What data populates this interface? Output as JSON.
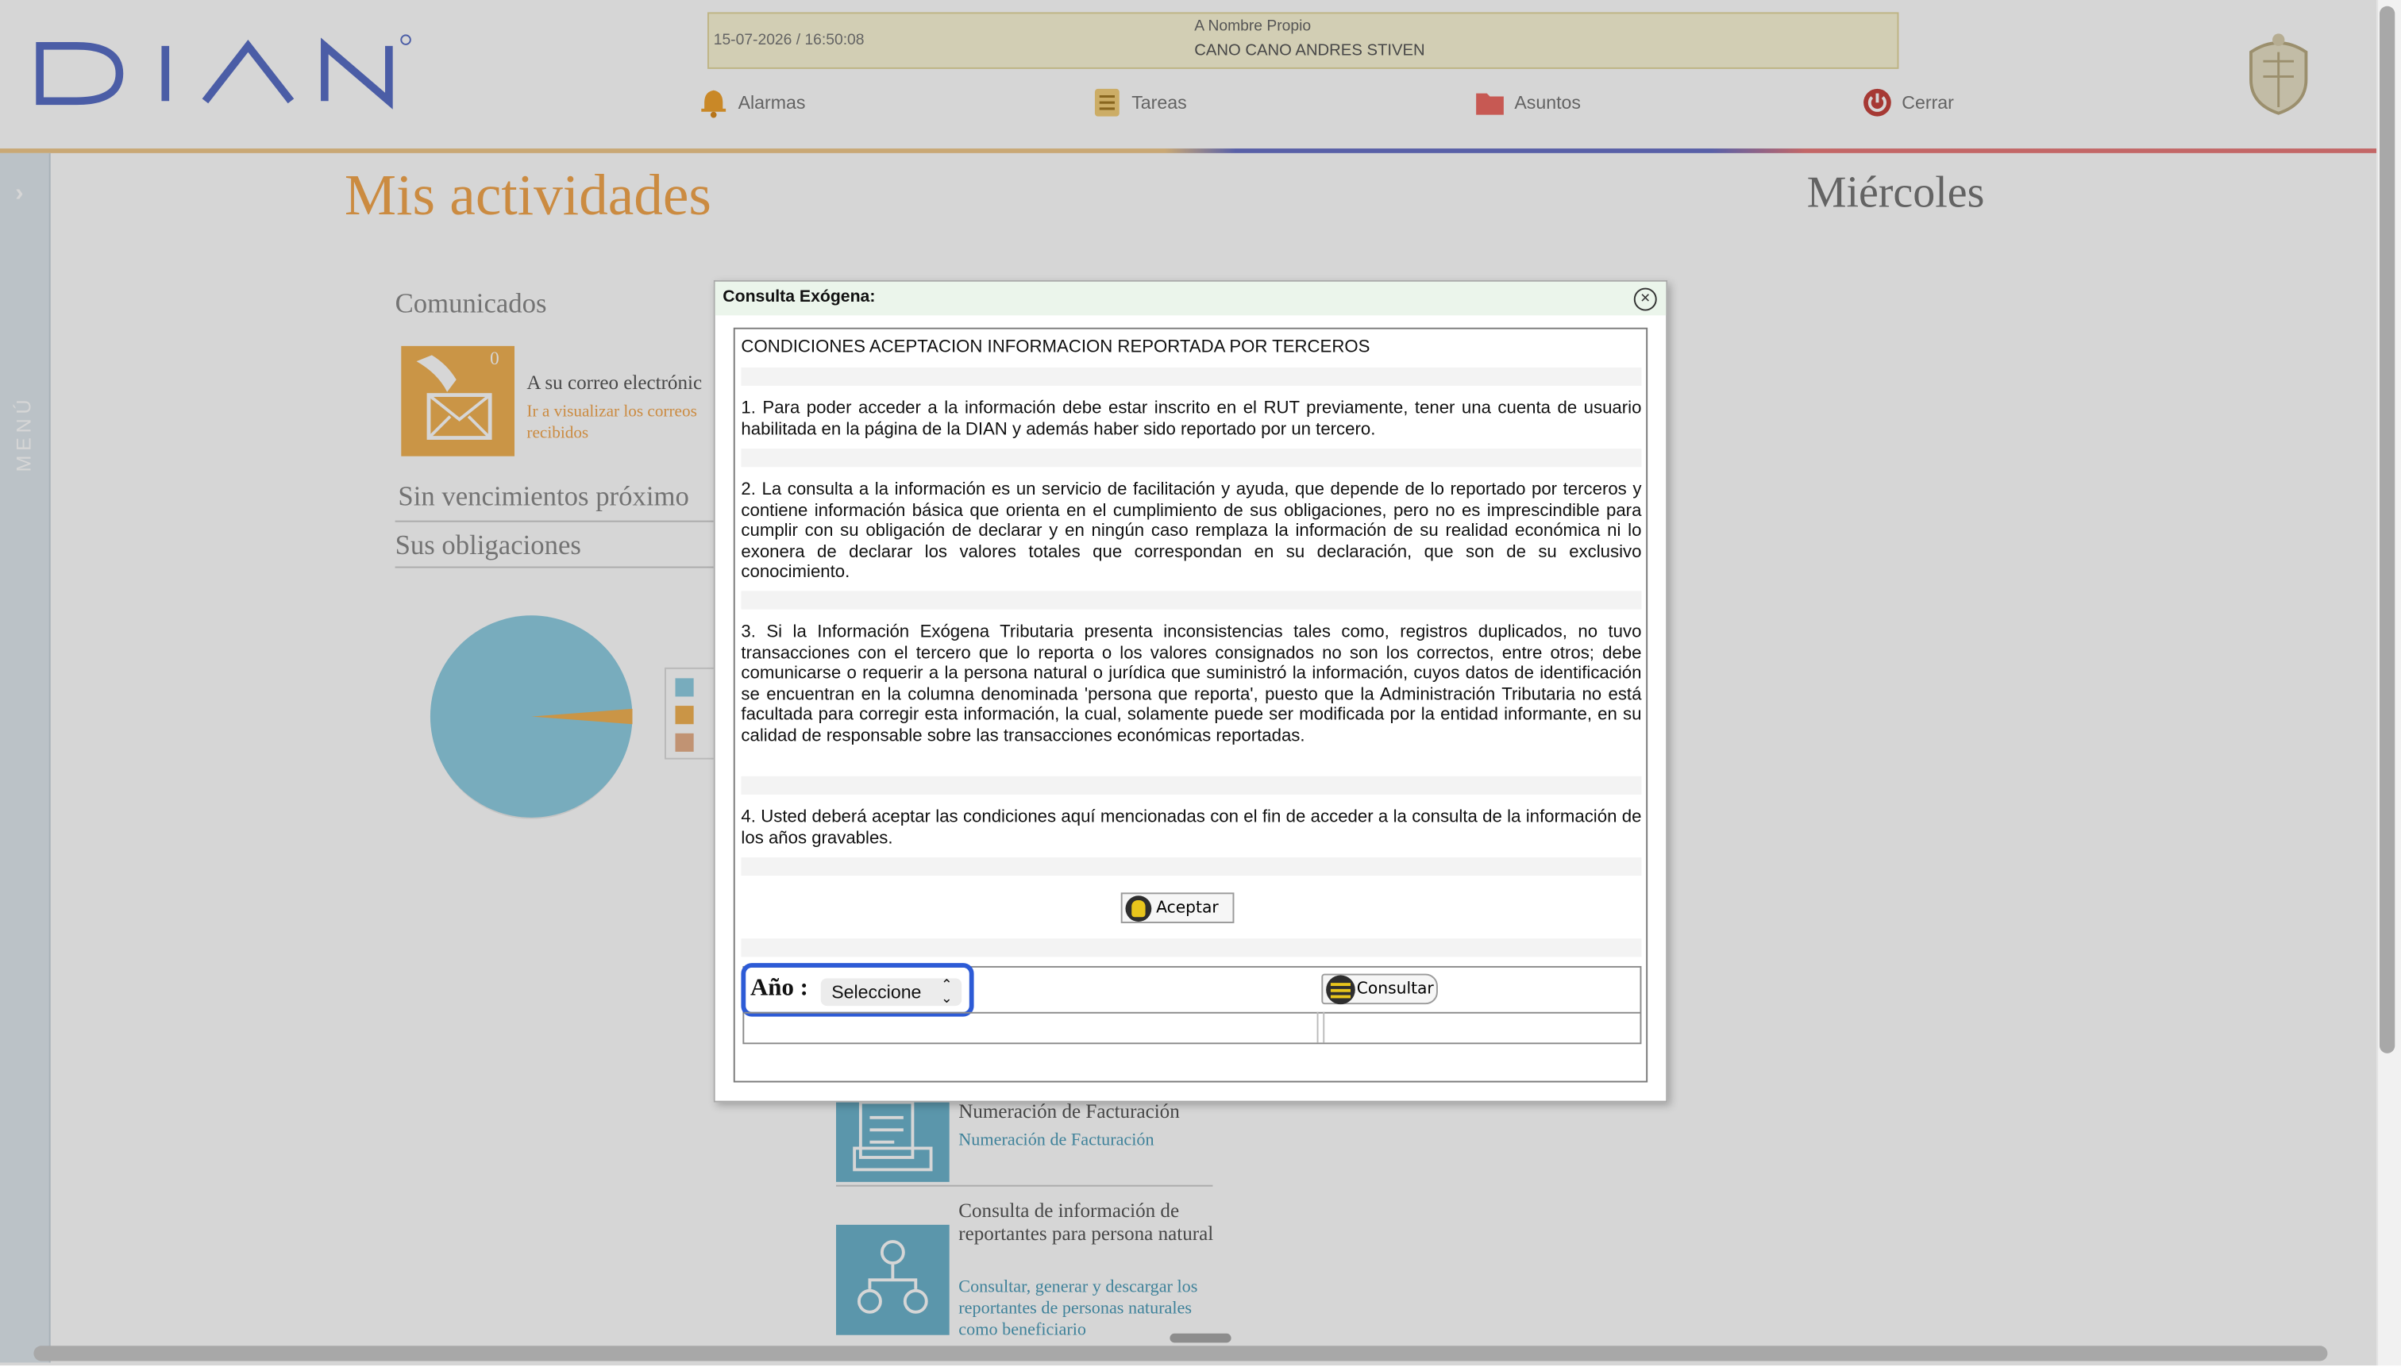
{
  "header": {
    "datetime": "15-07-2026 / 16:50:08",
    "user_type": "A Nombre Propio",
    "user_name": "CANO CANO ANDRES STIVEN",
    "nav": [
      "Alarmas",
      "Tareas",
      "Asuntos",
      "Cerrar"
    ]
  },
  "sidebar": {
    "label": "MENÚ"
  },
  "page": {
    "title": "Mis actividades",
    "day": "Miércoles",
    "comunicados": {
      "heading": "Comunicados",
      "count": "0",
      "title": "A su correo electrónic",
      "subtitle": "Ir a visualizar los correos recibidos"
    },
    "vencimientos": "Sin vencimientos próximo",
    "obligaciones": "Sus obligaciones",
    "tiles": [
      {
        "title": "Numeración de Facturación",
        "subtitle": "Numeración de Facturación"
      },
      {
        "title": "Consulta de información de reportantes para persona natural",
        "subtitle": "Consultar, generar y descargar los reportantes de personas naturales como beneficiario"
      }
    ]
  },
  "modal": {
    "title": "Consulta Exógena:",
    "heading": "CONDICIONES ACEPTACION INFORMACION REPORTADA POR TERCEROS",
    "paragraphs": [
      "1. Para poder acceder a la información debe estar inscrito en el RUT previamente, tener una cuenta de usuario habilitada en la página de la DIAN y además haber sido reportado por un tercero.",
      "2. La consulta a la información es un servicio de facilitación y ayuda, que depende de lo reportado por terceros y contiene información básica que orienta en el cumplimiento de sus obligaciones, pero no es imprescindible para cumplir con su obligación de declarar y en ningún caso remplaza la información de su realidad económica ni lo exonera de declarar los valores totales que correspondan en su declaración, que son de su exclusivo conocimiento.",
      "3. Si la Información Exógena Tributaria presenta inconsistencias tales como, registros duplicados, no tuvo transacciones con el tercero que lo reporta o los valores consignados no son los correctos, entre otros; debe comunicarse o requerir a la persona natural o jurídica que suministró la información, cuyos datos de identificación se encuentran en la columna denominada 'persona que reporta', puesto que la Administración Tributaria no está facultada para corregir esta información, la cual, solamente puede ser modificada por la entidad informante, en su calidad de responsable sobre las transacciones económicas reportadas.",
      "4. Usted deberá aceptar las condiciones aquí mencionadas con el fin de acceder a la consulta de la información de los años gravables."
    ],
    "accept_label": "Aceptar",
    "year_label": "Año :",
    "year_selected": "Seleccione",
    "consult_label": "Consultar"
  },
  "colors": {
    "brand_orange": "#f2a64e",
    "highlight_blue": "#2d5bd6",
    "modal_header": "#ebf5eb"
  }
}
